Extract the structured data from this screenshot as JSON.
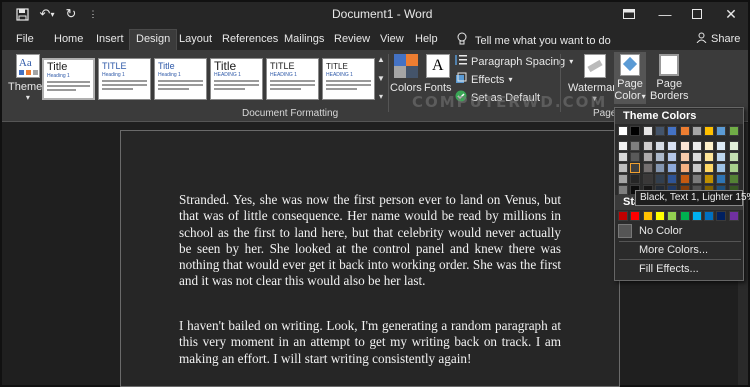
{
  "window": {
    "title": "Document1 - Word",
    "buttons": [
      "restore-ribbon",
      "minimize",
      "maximize",
      "close"
    ]
  },
  "qat": {
    "save_icon": "save-icon",
    "undo_icon": "undo-icon",
    "redo_icon": "redo-icon",
    "customize_icon": "more-icon"
  },
  "tabs": [
    {
      "label": "File"
    },
    {
      "label": "Home"
    },
    {
      "label": "Insert"
    },
    {
      "label": "Design",
      "active": true
    },
    {
      "label": "Layout"
    },
    {
      "label": "References"
    },
    {
      "label": "Mailings"
    },
    {
      "label": "Review"
    },
    {
      "label": "View"
    },
    {
      "label": "Help"
    }
  ],
  "tell_me": "Tell me what you want to do",
  "share": "Share",
  "ribbon": {
    "themes_label": "Themes",
    "style_thumbs": [
      {
        "title": "Title",
        "heading": "Heading 1"
      },
      {
        "title": "TITLE",
        "heading": "Heading 1"
      },
      {
        "title": "Title",
        "heading": "Heading 1"
      },
      {
        "title": "Title",
        "heading": "HEADING 1"
      },
      {
        "title": "TITLE",
        "heading": "HEADING 1"
      },
      {
        "title": "TITLE",
        "heading": "HEADING 1"
      }
    ],
    "doc_formatting_label": "Document Formatting",
    "colors_label": "Colors",
    "fonts_label": "Fonts",
    "paragraph_spacing": "Paragraph Spacing",
    "effects": "Effects",
    "set_default": "Set as Default",
    "watermark": "Watermark",
    "page_color_l1": "Page",
    "page_color_l2": "Color",
    "page_borders_l1": "Page",
    "page_borders_l2": "Borders",
    "page_bg_label": "Page B"
  },
  "watermark_overlay": "COMPUTERWD.COM",
  "document": {
    "para1": "Stranded. Yes, she was now the first person ever to land on Venus, but that was of little consequence. Her name would be read by millions in school as the first to land here, but that celebrity would never actually be seen by her. She looked at the control panel and knew there was nothing that would ever get it back into working order. She was the first and it was not clear this would also be her last.",
    "para2": "I haven't bailed on writing. Look, I'm generating a random paragraph at this very moment in an attempt to get my writing back on track. I am making an effort. I will start writing consistently again!"
  },
  "page_color_menu": {
    "theme_colors_label": "Theme Colors",
    "theme_top_row": [
      "#ffffff",
      "#000000",
      "#e7e6e6",
      "#44546a",
      "#4472c4",
      "#ed7d31",
      "#a5a5a5",
      "#ffc000",
      "#5b9bd5",
      "#70ad47"
    ],
    "theme_shades": [
      [
        "#f2f2f2",
        "#7f7f7f",
        "#d0cece",
        "#d6dce4",
        "#d9e2f3",
        "#fbe5d5",
        "#ededed",
        "#fff2cc",
        "#deebf6",
        "#e2efd9"
      ],
      [
        "#d8d8d8",
        "#595959",
        "#aeabab",
        "#adb9ca",
        "#b4c6e7",
        "#f7cbac",
        "#dbdbdb",
        "#fee599",
        "#bdd7ee",
        "#c5e0b3"
      ],
      [
        "#bfbfbf",
        "#3f3f3f",
        "#757070",
        "#8496b0",
        "#8eaadb",
        "#f4b183",
        "#c9c9c9",
        "#ffd966",
        "#9dc3e6",
        "#a8d08d"
      ],
      [
        "#a5a5a5",
        "#262626",
        "#3a3838",
        "#323f4f",
        "#2f5496",
        "#c55a11",
        "#7b7b7b",
        "#bf9000",
        "#2e75b5",
        "#538135"
      ],
      [
        "#7f7f7f",
        "#0c0c0c",
        "#171616",
        "#222a35",
        "#1f3864",
        "#833c0b",
        "#525252",
        "#7f6000",
        "#1e4e79",
        "#375623"
      ]
    ],
    "standard_colors_label": "Standard Colors",
    "standard_colors": [
      "#c00000",
      "#ff0000",
      "#ffc000",
      "#ffff00",
      "#92d050",
      "#00b050",
      "#00b0f0",
      "#0070c0",
      "#002060",
      "#7030a0"
    ],
    "no_color": "No Color",
    "more_colors": "More Colors...",
    "fill_effects": "Fill Effects...",
    "tooltip": "Black, Text 1, Lighter 15%"
  }
}
